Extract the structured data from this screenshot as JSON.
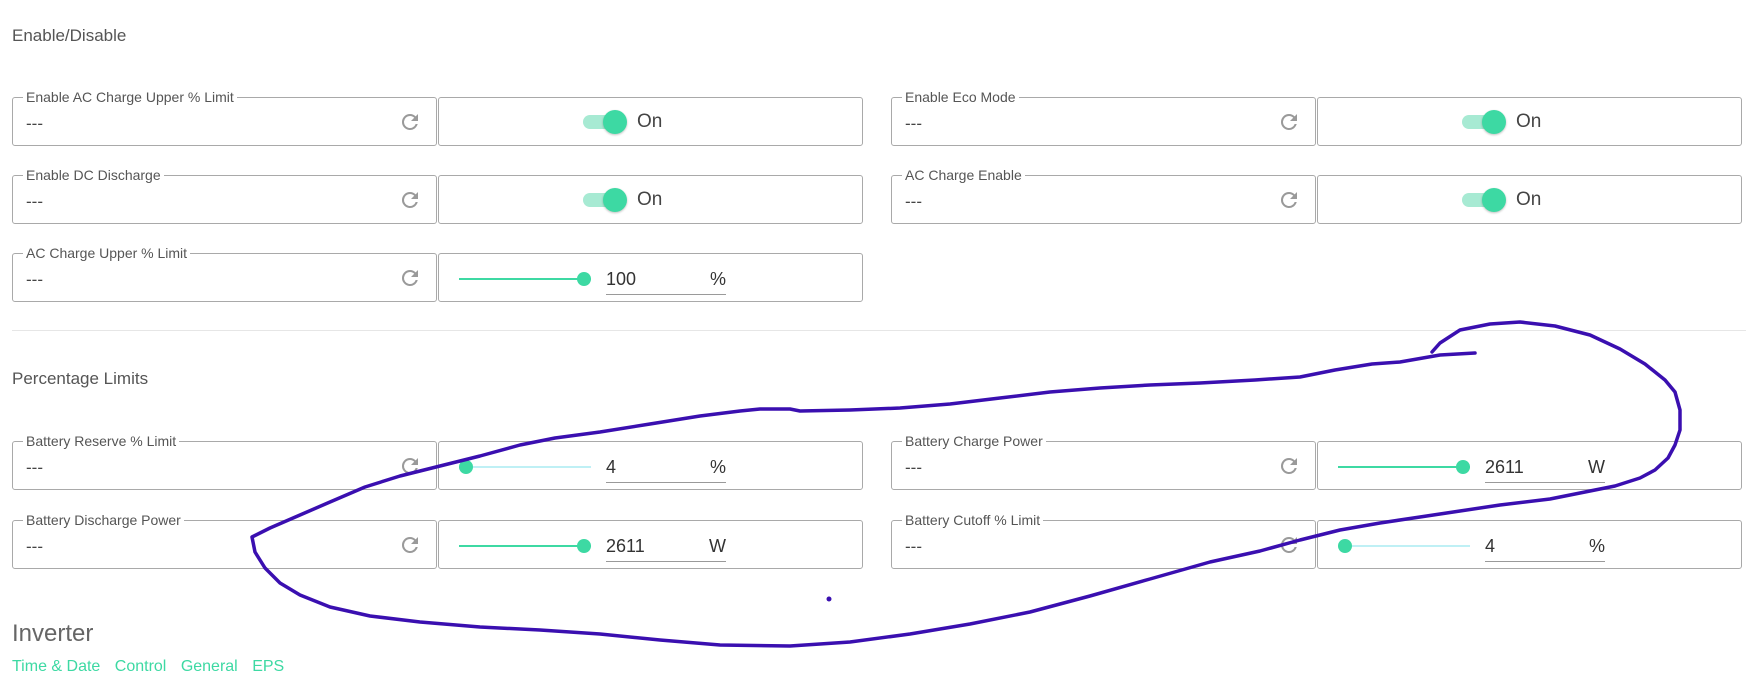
{
  "sections": {
    "enable_disable": "Enable/Disable",
    "percentage_limits": "Percentage Limits",
    "inverter": "Inverter"
  },
  "enable_disable": {
    "ac_charge_upper_enable": {
      "label": "Enable AC Charge Upper % Limit",
      "value": "---",
      "state": "On"
    },
    "eco_mode": {
      "label": "Enable Eco Mode",
      "value": "---",
      "state": "On"
    },
    "dc_discharge": {
      "label": "Enable DC Discharge",
      "value": "---",
      "state": "On"
    },
    "ac_charge_enable": {
      "label": "AC Charge Enable",
      "value": "---",
      "state": "On"
    },
    "ac_charge_upper": {
      "label": "AC Charge Upper % Limit",
      "value": "---",
      "input": "100",
      "unit": "%",
      "level": 1.0
    }
  },
  "percentage_limits": {
    "battery_reserve": {
      "label": "Battery Reserve % Limit",
      "value": "---",
      "input": "4",
      "unit": "%",
      "level": 0.0
    },
    "battery_charge_power": {
      "label": "Battery Charge Power",
      "value": "---",
      "input": "2611",
      "unit": "W",
      "level": 1.0
    },
    "battery_discharge_power": {
      "label": "Battery Discharge Power",
      "value": "---",
      "input": "2611",
      "unit": "W",
      "level": 1.0
    },
    "battery_cutoff": {
      "label": "Battery Cutoff % Limit",
      "value": "---",
      "input": "4",
      "unit": "%",
      "level": 0.0
    }
  },
  "tabs": [
    "Time & Date",
    "Control",
    "General",
    "EPS"
  ],
  "colors": {
    "accent": "#3dd9a3",
    "annotation": "#3a0fb0"
  }
}
